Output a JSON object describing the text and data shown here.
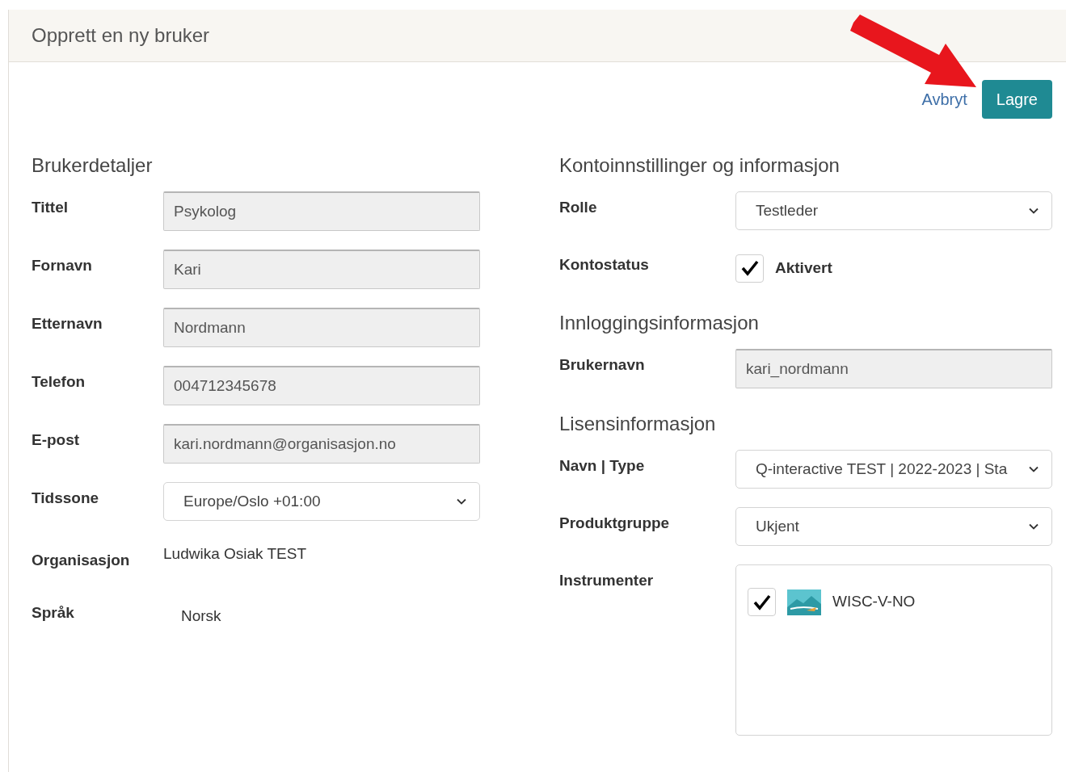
{
  "title": "Opprett en ny bruker",
  "actions": {
    "cancel": "Avbryt",
    "save": "Lagre"
  },
  "left": {
    "heading": "Brukerdetaljer",
    "fields": [
      {
        "kind": "input",
        "label": "Tittel",
        "value": "Psykolog"
      },
      {
        "kind": "input",
        "label": "Fornavn",
        "value": "Kari"
      },
      {
        "kind": "input",
        "label": "Etternavn",
        "value": "Nordmann"
      },
      {
        "kind": "input",
        "label": "Telefon",
        "value": "004712345678"
      },
      {
        "kind": "input",
        "label": "E-post",
        "value": "kari.nordmann@organisasjon.no"
      },
      {
        "kind": "select",
        "label": "Tidssone",
        "value": "Europe/Oslo +01:00"
      },
      {
        "kind": "text",
        "label": "Organisasjon",
        "value": "Ludwika Osiak TEST"
      },
      {
        "kind": "text",
        "label": "Språk",
        "value": "Norsk"
      }
    ]
  },
  "right": [
    {
      "heading": "Kontoinnstillinger og informasjon",
      "fields": [
        {
          "kind": "select",
          "label": "Rolle",
          "value": "Testleder"
        },
        {
          "kind": "checkbox",
          "label": "Kontostatus",
          "value": "Aktivert",
          "checked": true
        }
      ]
    },
    {
      "heading": "Innloggingsinformasjon",
      "fields": [
        {
          "kind": "input",
          "label": "Brukernavn",
          "value": "kari_nordmann"
        }
      ]
    },
    {
      "heading": "Lisensinformasjon",
      "fields": [
        {
          "kind": "select",
          "label": "Navn | Type",
          "value": "Q-interactive TEST | 2022-2023 | Sta"
        },
        {
          "kind": "select",
          "label": "Produktgruppe",
          "value": "Ukjent"
        },
        {
          "kind": "list",
          "label": "Instrumenter",
          "items": [
            {
              "label": "WISC-V-NO",
              "checked": true
            }
          ]
        }
      ]
    }
  ]
}
